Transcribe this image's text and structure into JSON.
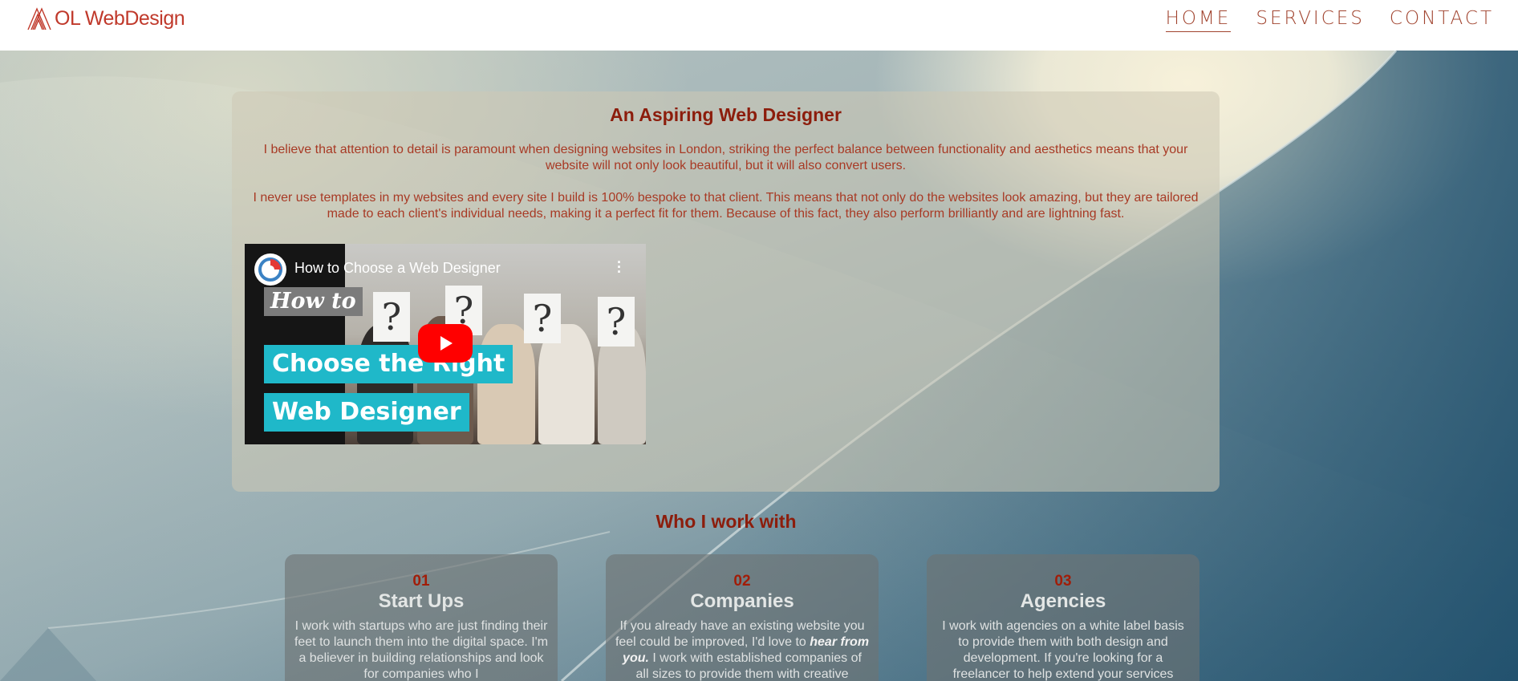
{
  "brand": {
    "name": "OL WebDesign",
    "logo_icon": "stacked-triangle-logo-icon",
    "color": "#c0392b"
  },
  "nav": {
    "items": [
      {
        "label": "HOME",
        "active": true
      },
      {
        "label": "SERVICES",
        "active": false
      },
      {
        "label": "CONTACT",
        "active": false
      }
    ]
  },
  "intro": {
    "title": "An Aspiring Web Designer",
    "paragraph1": "I believe that attention to detail is paramount when designing websites in London, striking the perfect balance between functionality and aesthetics means that your website will not only look beautiful, but it will also convert users.",
    "paragraph2": "I never use templates in my websites and every site I build is 100% bespoke to that client. This means that not only do the websites look amazing, but they are tailored made to each client's individual needs, making it a perfect fit for them. Because of this fact, they also perform brilliantly and are lightning fast."
  },
  "video": {
    "title": "How to Choose a Web Designer",
    "thumb_line1": "How to",
    "thumb_line2": "Choose the Right",
    "thumb_line3": "Web Designer",
    "question_mark": "?"
  },
  "who": {
    "title": "Who I work with",
    "cards": [
      {
        "num": "01",
        "title": "Start Ups",
        "body": "I work with startups who are just finding their feet to launch them into the digital space. I'm a believer in building relationships and look for companies who I"
      },
      {
        "num": "02",
        "title": "Companies",
        "body_pre": "If you already have an existing website you feel could be improved, I'd love to ",
        "body_bold": "hear from you.",
        "body_post": " I work with established companies of all sizes to provide them with creative"
      },
      {
        "num": "03",
        "title": "Agencies",
        "body": "I work with agencies on a white label basis to provide them with both design and development. If you're looking for a freelancer to help extend your services"
      }
    ]
  },
  "colors": {
    "heading": "#8c1d0c",
    "body_text": "#a83a25",
    "nav_text": "#a1442f",
    "youtube_red": "#ff0000",
    "thumb_teal": "#1fb8c9"
  }
}
